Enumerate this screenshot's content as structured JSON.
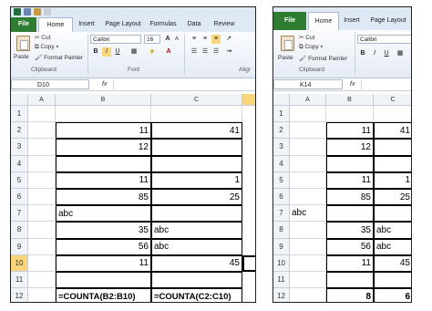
{
  "left": {
    "tabs": [
      "File",
      "Home",
      "Insert",
      "Page Layout",
      "Formulas",
      "Data",
      "Review"
    ],
    "clipboard": {
      "cut": "Cut",
      "copy": "Copy",
      "format_painter": "Format Painter",
      "paste": "Paste",
      "group": "Clipboard"
    },
    "font": {
      "name": "Calibri",
      "size": "16",
      "group": "Font",
      "bold": "B",
      "italic": "I",
      "underline": "U",
      "grow": "A",
      "shrink": "A"
    },
    "align_group": "Aligr",
    "name_box": "D10",
    "fx": "fx",
    "columns": [
      "A",
      "B",
      "C"
    ],
    "rows": [
      "1",
      "2",
      "3",
      "4",
      "5",
      "6",
      "7",
      "8",
      "9",
      "10",
      "11",
      "12"
    ],
    "cells": {
      "b2": "11",
      "c2": "41",
      "b3": "12",
      "b5": "11",
      "c5": "1",
      "b6": "85",
      "c6": "25",
      "b7": "abc",
      "b8": "35",
      "c8": "abc",
      "b9": "56",
      "c9": "abc",
      "b10": "11",
      "c10": "45",
      "b12": "=COUNTA(B2:B10)",
      "c12": "=COUNTA(C2:C10)"
    }
  },
  "right": {
    "tabs": [
      "File",
      "Home",
      "Insert",
      "Page Layout"
    ],
    "clipboard": {
      "cut": "Cut",
      "copy": "Copy",
      "format_painter": "Format Painter",
      "paste": "Paste",
      "group": "Clipboard"
    },
    "font": {
      "name": "Calibri",
      "bold": "B",
      "italic": "I",
      "underline": "U"
    },
    "name_box": "K14",
    "fx": "fx",
    "columns": [
      "A",
      "B",
      "C"
    ],
    "rows": [
      "1",
      "2",
      "3",
      "4",
      "5",
      "6",
      "7",
      "8",
      "9",
      "10",
      "11",
      "12"
    ],
    "cells": {
      "b2": "11",
      "c2": "41",
      "b3": "12",
      "b5": "11",
      "c5": "1",
      "b6": "85",
      "c6": "25",
      "a7": "abc",
      "b8": "35",
      "c8": "abc",
      "b9": "56",
      "c9": "abc",
      "b10": "11",
      "c10": "45",
      "b12": "8",
      "c12": "6"
    }
  },
  "colors": {
    "file_tab": "#2f7d32",
    "ribbon_bg": "#dfe8f5",
    "selected_header": "#f9d67c"
  }
}
